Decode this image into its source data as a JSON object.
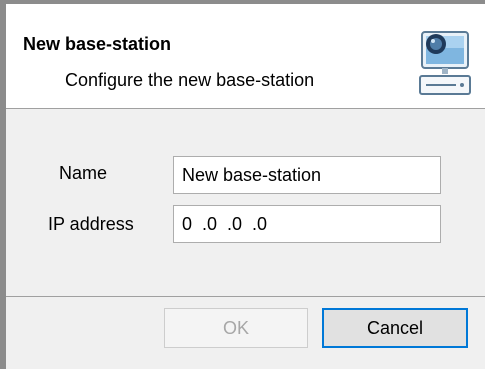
{
  "dialog": {
    "title": "New base-station",
    "subtitle": "Configure the new base-station",
    "header_icon": "computer-monitor-icon"
  },
  "form": {
    "name_label": "Name",
    "name_value": "New base-station",
    "ip_label": "IP address",
    "ip_value": "0  .0  .0  .0"
  },
  "buttons": {
    "ok_label": "OK",
    "ok_enabled": false,
    "cancel_label": "Cancel"
  },
  "colors": {
    "focus_border": "#0078d7",
    "disabled_text": "#a7a7a7"
  }
}
